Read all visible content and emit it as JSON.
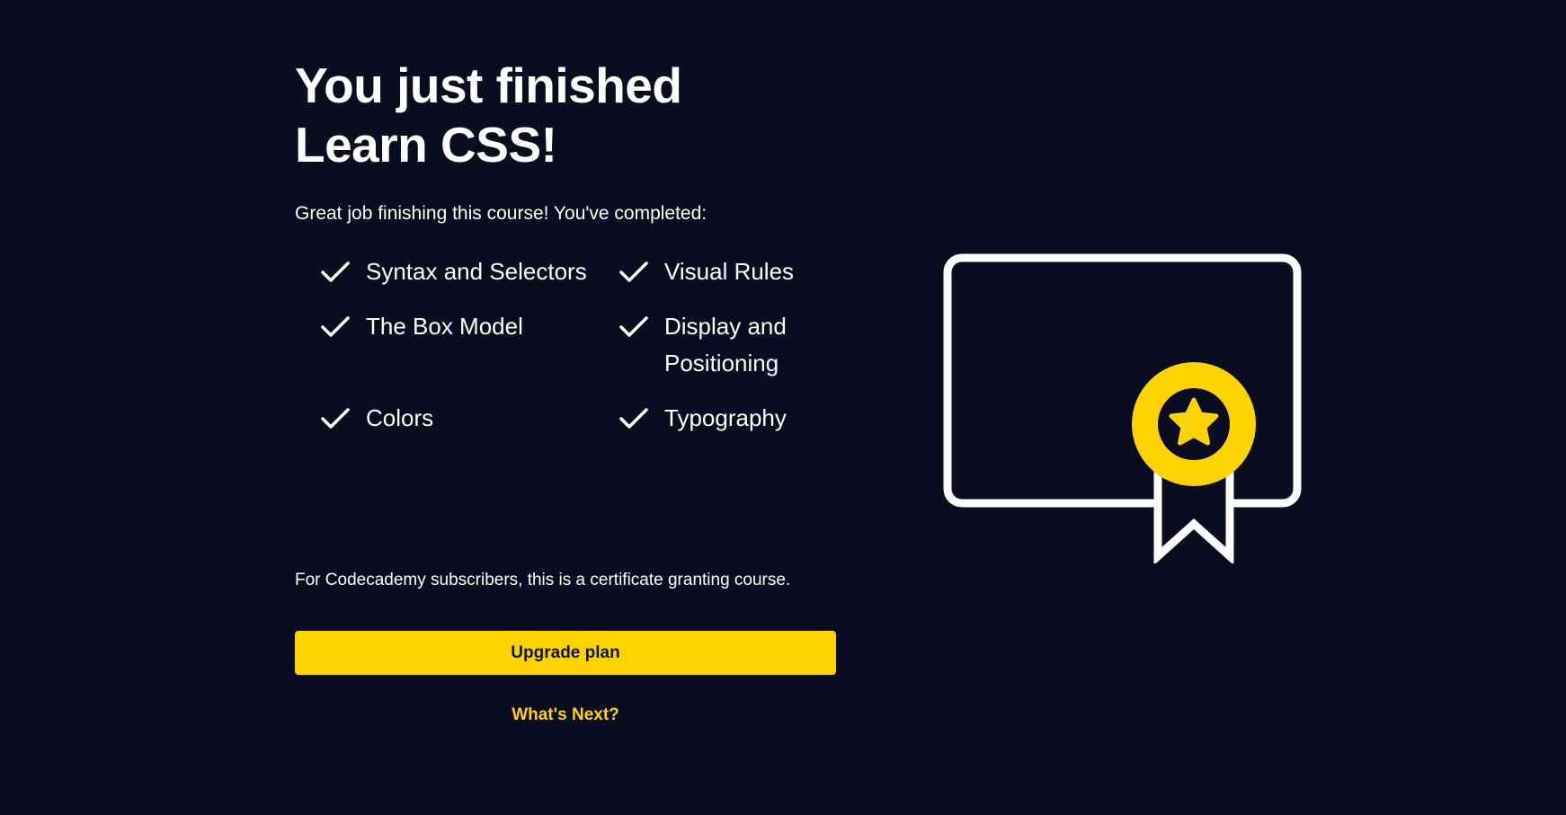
{
  "heading": {
    "line1": "You just finished",
    "line2": "Learn CSS!"
  },
  "subtitle": "Great job finishing this course! You've completed:",
  "completed_lessons": [
    "Syntax and Selectors",
    "Visual Rules",
    "The Box Model",
    "Display and Positioning",
    "Colors",
    "Typography"
  ],
  "certificate_notice": "For Codecademy subscribers, this is a certificate granting course.",
  "upgrade_button_label": "Upgrade plan",
  "whats_next_label": "What's Next?",
  "icons": {
    "check": "check-icon",
    "certificate": "certificate-icon",
    "badge": "award-badge-icon",
    "star": "star-icon"
  },
  "colors": {
    "background": "#0a0d1f",
    "text": "#ffffff",
    "accent": "#ffd300",
    "button_text": "#10162f"
  }
}
